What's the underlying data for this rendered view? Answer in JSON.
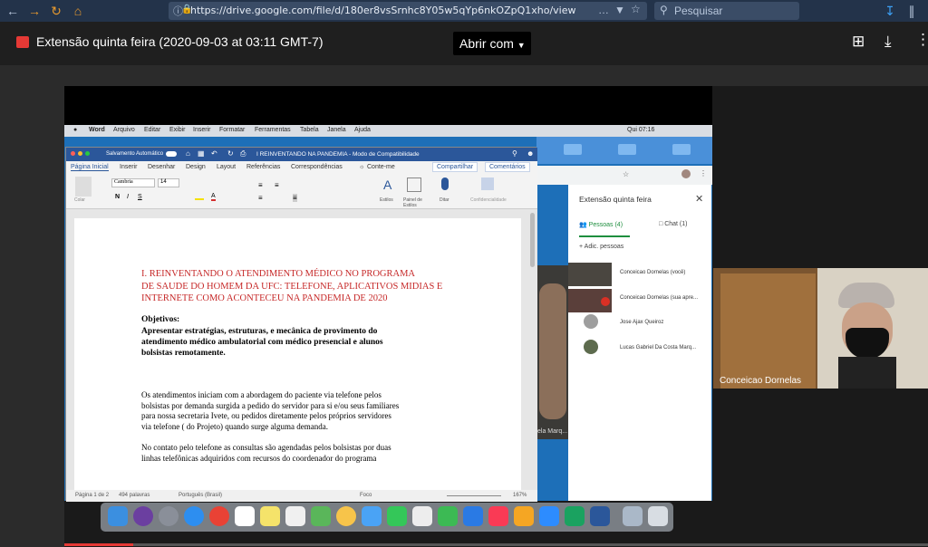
{
  "browser": {
    "url": "https://drive.google.com/file/d/180er8vsSrnhc8Y05w5qYp6nkOZpQ1xho/view",
    "search_placeholder": "Pesquisar"
  },
  "viewer": {
    "file_title": "Extensão quinta feira (2020-09-03 at 03:11 GMT-7)",
    "open_with_label": "Abrir com"
  },
  "mac_menu": [
    "Word",
    "Arquivo",
    "Editar",
    "Exibir",
    "Inserir",
    "Formatar",
    "Ferramentas",
    "Tabela",
    "Janela",
    "Ajuda"
  ],
  "mac_clock": "Qui 07:16",
  "word": {
    "autosave": "Salvamento Automático",
    "doc_title": "I REINVENTANDO NA PANDEMIA  -  Modo de Compatibilidade",
    "tabs": [
      "Página Inicial",
      "Inserir",
      "Desenhar",
      "Design",
      "Layout",
      "Referências",
      "Correspondências",
      "Conte-me"
    ],
    "share": "Compartilhar",
    "comments": "Comentários",
    "font": "Cambria",
    "size": "14",
    "ribbon_labels": [
      "Colar",
      "Estilos",
      "Painel de Estilos",
      "Ditar",
      "Confidencialidade"
    ],
    "status": [
      "Página 1 de 2",
      "494 palavras",
      "Português (Brasil)",
      "Foco",
      "167%"
    ],
    "heading_lines": [
      "I.      REINVENTANDO O ATENDIMENTO MÉDICO NO PROGRAMA",
      "DE SAUDE DO HOMEM DA UFC: TELEFONE, APLICATIVOS MIDIAS E",
      "INTERNETE COMO ACONTECEU NA PANDEMIA DE 2020"
    ],
    "objetivos_label": "Objetivos:",
    "objetivos_lines": [
      "Apresentar estratégias, estruturas, e mecânica de provimento do",
      "atendimento médico ambulatorial com médico presencial e alunos",
      "bolsistas remotamente."
    ],
    "para1": [
      "Os atendimentos iniciam com a abordagem do paciente via telefone pelos",
      "bolsistas por demanda surgida a pedido do servidor para si e/ou seus familiares",
      "para nossa secretaria Ivete, ou pedidos diretamente pelos próprios servidores",
      "via telefone ( do Projeto) quando surge alguma demanda."
    ],
    "para2": [
      "No contato pelo telefone as consultas são agendadas pelos bolsistas por duas",
      "linhas telefônicas adquiridos com recursos do coordenador do programa"
    ]
  },
  "meet": {
    "title": "Extensão quinta feira",
    "tab_people": "Pessoas (4)",
    "tab_chat": "Chat (1)",
    "add_people": "Adic. pessoas",
    "participants": [
      "Conceicao Dornelas (você)",
      "Conceicao Dornelas (sua apre...",
      "Jose Ajax Queiroz",
      "Lucas Gabriel Da Costa Marq..."
    ],
    "cam_label": "Conceicao Dornelas",
    "side_label": "ela Marq..."
  },
  "colors": {
    "heading_red": "#c62828",
    "word_blue": "#2b579a",
    "meet_green": "#1e8e3e"
  }
}
